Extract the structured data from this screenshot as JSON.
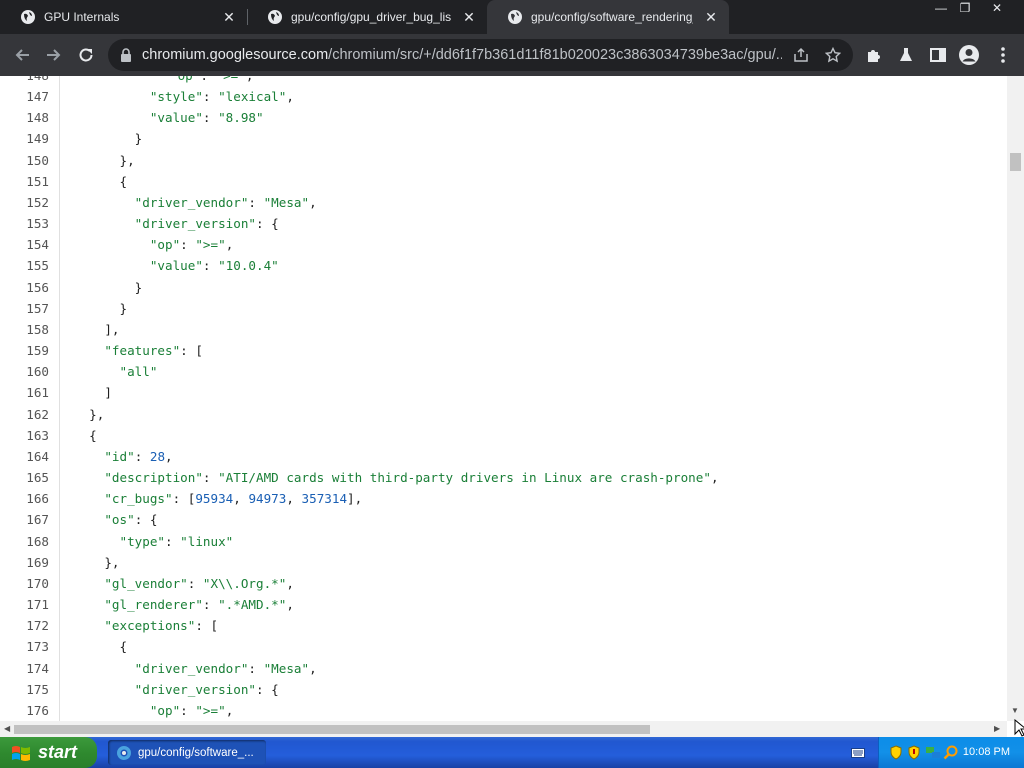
{
  "tabs": [
    {
      "title": "GPU Internals",
      "icon": "globe-icon",
      "active": false
    },
    {
      "title": "gpu/config/gpu_driver_bug_list.json",
      "icon": "globe-icon",
      "active": false
    },
    {
      "title": "gpu/config/software_rendering_list",
      "icon": "globe-icon",
      "active": true
    }
  ],
  "window_controls": {
    "minimize": "—",
    "restore": "❐",
    "close": "✕"
  },
  "omnibox": {
    "host": "chromium.googlesource.com",
    "path": "/chromium/src/+/dd6f1f7b361d11f81b020023c3863034739be3ac/gpu/..."
  },
  "code": {
    "first_partial_line": "\"op\": \">=\",",
    "lines": [
      {
        "n": "147",
        "text": "          \"style\": \"lexical\","
      },
      {
        "n": "148",
        "text": "          \"value\": \"8.98\""
      },
      {
        "n": "149",
        "text": "        }"
      },
      {
        "n": "150",
        "text": "      },"
      },
      {
        "n": "151",
        "text": "      {"
      },
      {
        "n": "152",
        "text": "        \"driver_vendor\": \"Mesa\","
      },
      {
        "n": "153",
        "text": "        \"driver_version\": {"
      },
      {
        "n": "154",
        "text": "          \"op\": \">=\","
      },
      {
        "n": "155",
        "text": "          \"value\": \"10.0.4\""
      },
      {
        "n": "156",
        "text": "        }"
      },
      {
        "n": "157",
        "text": "      }"
      },
      {
        "n": "158",
        "text": "    ],"
      },
      {
        "n": "159",
        "text": "    \"features\": ["
      },
      {
        "n": "160",
        "text": "      \"all\""
      },
      {
        "n": "161",
        "text": "    ]"
      },
      {
        "n": "162",
        "text": "  },"
      },
      {
        "n": "163",
        "text": "  {"
      },
      {
        "n": "164",
        "text": "    \"id\": 28,"
      },
      {
        "n": "165",
        "text": "    \"description\": \"ATI/AMD cards with third-party drivers in Linux are crash-prone\","
      },
      {
        "n": "166",
        "text": "    \"cr_bugs\": [95934, 94973, 357314],"
      },
      {
        "n": "167",
        "text": "    \"os\": {"
      },
      {
        "n": "168",
        "text": "      \"type\": \"linux\""
      },
      {
        "n": "169",
        "text": "    },"
      },
      {
        "n": "170",
        "text": "    \"gl_vendor\": \"X\\\\.Org.*\","
      },
      {
        "n": "171",
        "text": "    \"gl_renderer\": \".*AMD.*\","
      },
      {
        "n": "172",
        "text": "    \"exceptions\": ["
      },
      {
        "n": "173",
        "text": "      {"
      },
      {
        "n": "174",
        "text": "        \"driver_vendor\": \"Mesa\","
      },
      {
        "n": "175",
        "text": "        \"driver_version\": {"
      },
      {
        "n": "176",
        "text": "          \"op\": \">=\","
      }
    ]
  },
  "taskbar": {
    "start_label": "start",
    "task_label": "gpu/config/software_...",
    "clock": "10:08 PM"
  },
  "colors": {
    "tab_strip": "#202124",
    "toolbar": "#35363a",
    "string": "#1a7f37",
    "number": "#1a5fb4",
    "taskbar": "#245edb",
    "start": "#2f8a2f"
  }
}
